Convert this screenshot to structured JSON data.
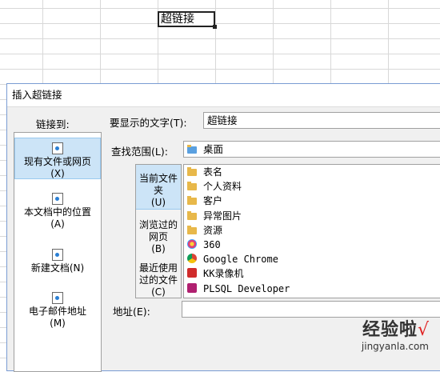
{
  "sheet": {
    "active_cell_text": "超链接"
  },
  "dialog": {
    "title": "插入超链接",
    "link_to_label": "链接到:",
    "link_to_items": [
      {
        "label": "现有文件或网页",
        "key": "(X)"
      },
      {
        "label": "本文档中的位置",
        "key": "(A)"
      },
      {
        "label": "新建文档",
        "key": "(N)"
      },
      {
        "label": "电子邮件地址",
        "key": "(M)"
      }
    ],
    "display_text_label": "要显示的文字(T):",
    "display_text_value": "超链接",
    "look_in_label": "查找范围(L):",
    "look_in_value": "桌面",
    "subnav": [
      {
        "label": "当前文件夹",
        "key": "(U)"
      },
      {
        "label": "浏览过的网页",
        "key": "(B)"
      },
      {
        "label": "最近使用过的文件",
        "key": "(C)"
      }
    ],
    "files": [
      {
        "name": "表名",
        "icon": "folder-icon"
      },
      {
        "name": "个人资料",
        "icon": "folder-icon"
      },
      {
        "name": "客户",
        "icon": "folder-icon"
      },
      {
        "name": "异常图片",
        "icon": "folder-icon"
      },
      {
        "name": "资源",
        "icon": "folder-icon"
      },
      {
        "name": "360",
        "icon": "app-icon"
      },
      {
        "name": "Google Chrome",
        "icon": "chrome-icon"
      },
      {
        "name": "KK录像机",
        "icon": "app-icon"
      },
      {
        "name": "PLSQL Developer",
        "icon": "app-icon"
      }
    ],
    "address_label": "地址(E):",
    "address_value": ""
  },
  "watermark": {
    "main": "经验啦",
    "check": "√",
    "url": "jingyanla.com"
  }
}
